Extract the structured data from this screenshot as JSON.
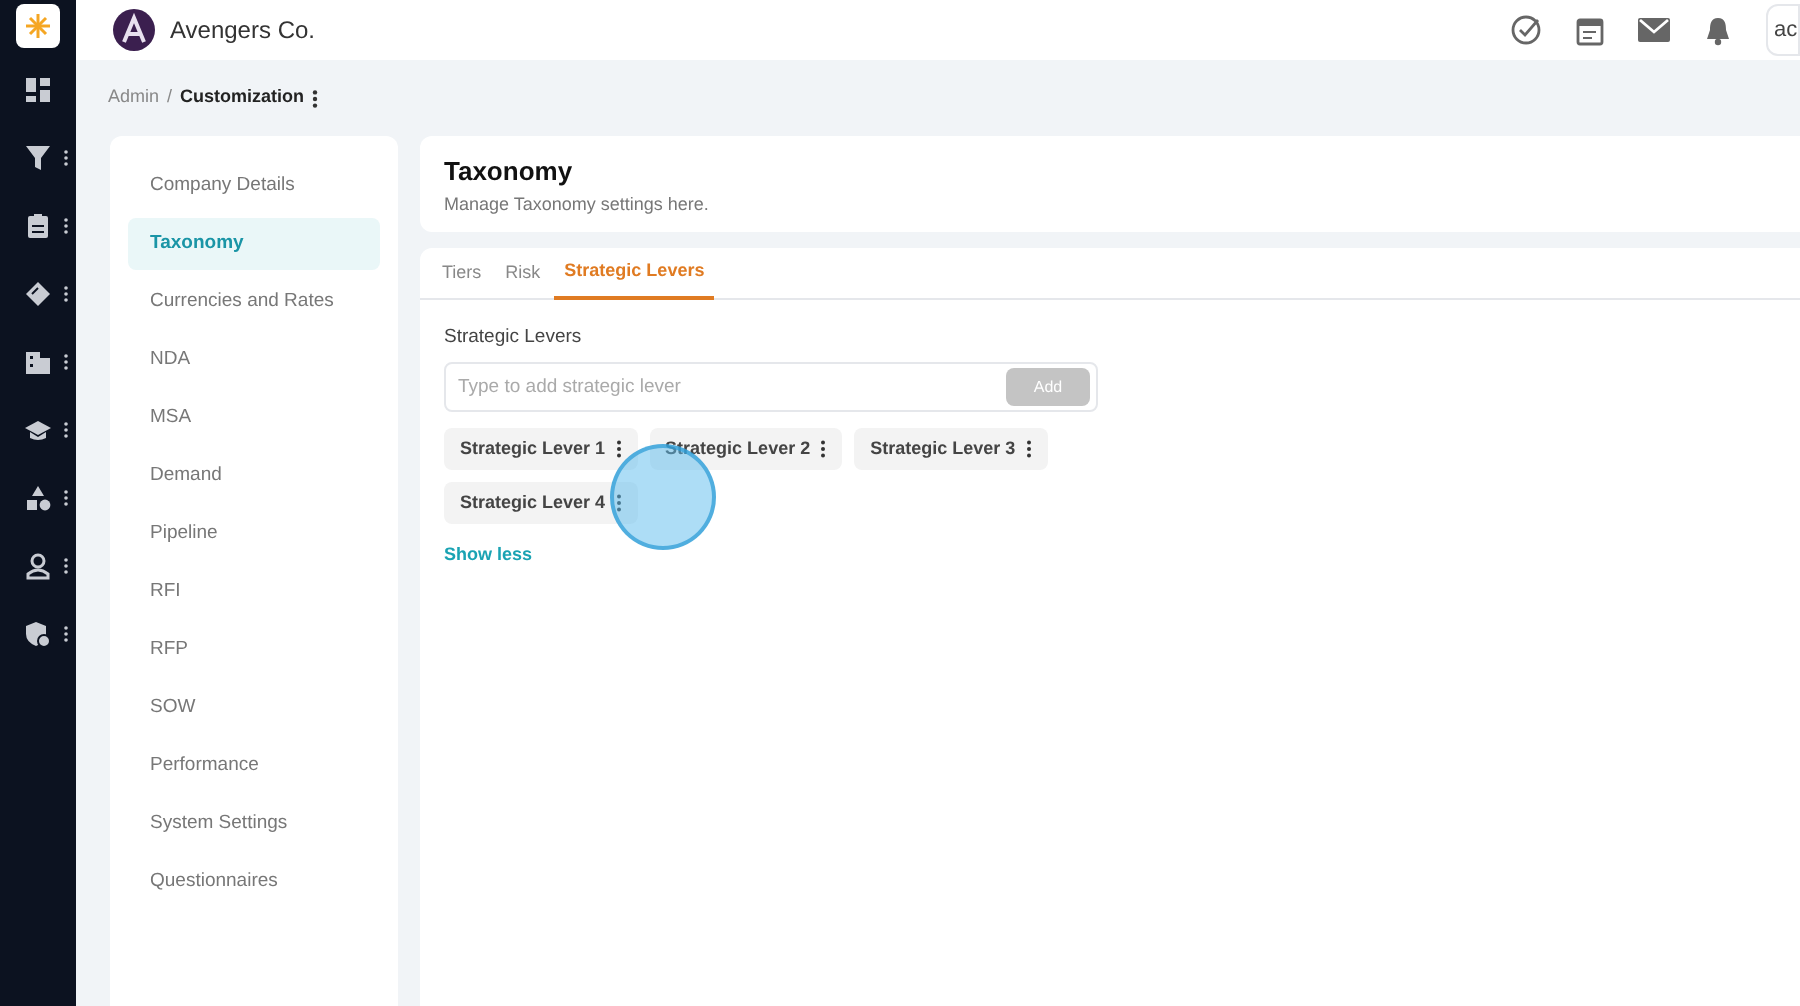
{
  "rail": {
    "items": [
      {
        "menu": false
      },
      {
        "menu": true
      },
      {
        "menu": true
      },
      {
        "menu": true
      },
      {
        "menu": true
      },
      {
        "menu": true
      },
      {
        "menu": true
      },
      {
        "menu": true
      },
      {
        "menu": true
      }
    ]
  },
  "header": {
    "company": "Avengers Co.",
    "user_button": "ac"
  },
  "breadcrumb": {
    "parent": "Admin",
    "separator": "/",
    "current": "Customization"
  },
  "settings_menu": [
    {
      "label": "Company Details",
      "selected": false
    },
    {
      "label": "Taxonomy",
      "selected": true
    },
    {
      "label": "Currencies and Rates",
      "selected": false
    },
    {
      "label": "NDA",
      "selected": false
    },
    {
      "label": "MSA",
      "selected": false
    },
    {
      "label": "Demand",
      "selected": false
    },
    {
      "label": "Pipeline",
      "selected": false
    },
    {
      "label": "RFI",
      "selected": false
    },
    {
      "label": "RFP",
      "selected": false
    },
    {
      "label": "SOW",
      "selected": false
    },
    {
      "label": "Performance",
      "selected": false
    },
    {
      "label": "System Settings",
      "selected": false
    },
    {
      "label": "Questionnaires",
      "selected": false
    }
  ],
  "page": {
    "title": "Taxonomy",
    "subtitle": "Manage Taxonomy settings here."
  },
  "tabs": [
    {
      "label": "Tiers",
      "selected": false
    },
    {
      "label": "Risk",
      "selected": false
    },
    {
      "label": "Strategic Levers",
      "selected": true
    }
  ],
  "levers": {
    "label": "Strategic Levers",
    "placeholder": "Type to add strategic lever",
    "add_button": "Add",
    "add_disabled": true,
    "chips": [
      "Strategic Lever 1",
      "Strategic Lever 2",
      "Strategic Lever 3",
      "Strategic Lever 4"
    ],
    "toggle": "Show less"
  }
}
